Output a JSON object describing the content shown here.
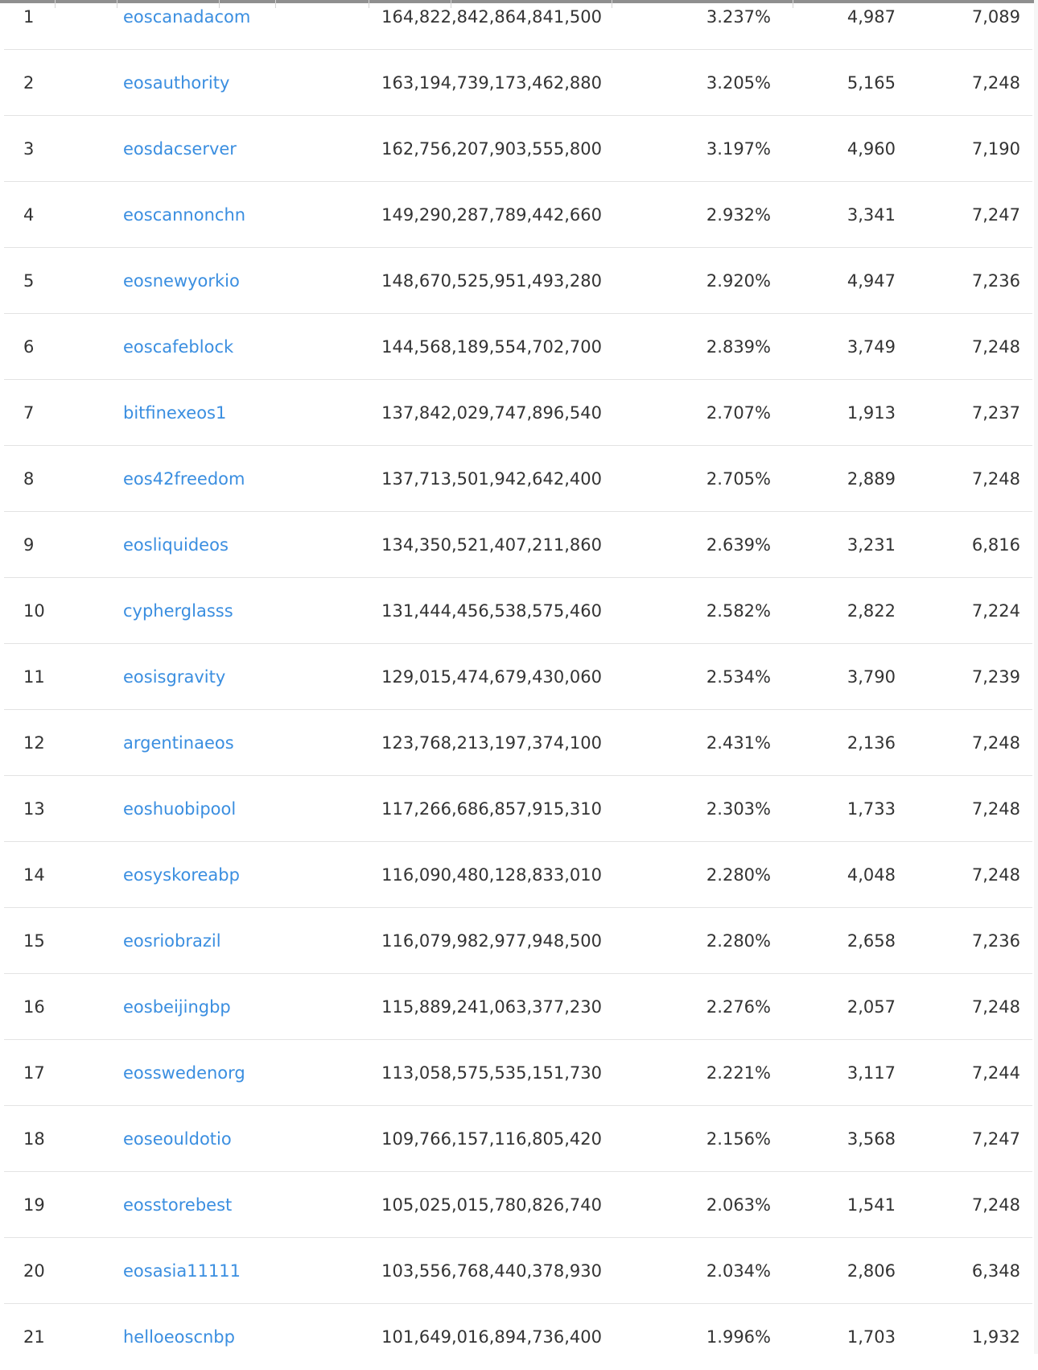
{
  "table": {
    "rows": [
      {
        "rank": "1",
        "name": "eoscanadacom",
        "votes": "164,822,842,864,841,500",
        "percent": "3.237%",
        "produced": "4,987",
        "total": "7,089"
      },
      {
        "rank": "2",
        "name": "eosauthority",
        "votes": "163,194,739,173,462,880",
        "percent": "3.205%",
        "produced": "5,165",
        "total": "7,248"
      },
      {
        "rank": "3",
        "name": "eosdacserver",
        "votes": "162,756,207,903,555,800",
        "percent": "3.197%",
        "produced": "4,960",
        "total": "7,190"
      },
      {
        "rank": "4",
        "name": "eoscannonchn",
        "votes": "149,290,287,789,442,660",
        "percent": "2.932%",
        "produced": "3,341",
        "total": "7,247"
      },
      {
        "rank": "5",
        "name": "eosnewyorkio",
        "votes": "148,670,525,951,493,280",
        "percent": "2.920%",
        "produced": "4,947",
        "total": "7,236"
      },
      {
        "rank": "6",
        "name": "eoscafeblock",
        "votes": "144,568,189,554,702,700",
        "percent": "2.839%",
        "produced": "3,749",
        "total": "7,248"
      },
      {
        "rank": "7",
        "name": "bitfinexeos1",
        "votes": "137,842,029,747,896,540",
        "percent": "2.707%",
        "produced": "1,913",
        "total": "7,237"
      },
      {
        "rank": "8",
        "name": "eos42freedom",
        "votes": "137,713,501,942,642,400",
        "percent": "2.705%",
        "produced": "2,889",
        "total": "7,248"
      },
      {
        "rank": "9",
        "name": "eosliquideos",
        "votes": "134,350,521,407,211,860",
        "percent": "2.639%",
        "produced": "3,231",
        "total": "6,816"
      },
      {
        "rank": "10",
        "name": "cypherglasss",
        "votes": "131,444,456,538,575,460",
        "percent": "2.582%",
        "produced": "2,822",
        "total": "7,224"
      },
      {
        "rank": "11",
        "name": "eosisgravity",
        "votes": "129,015,474,679,430,060",
        "percent": "2.534%",
        "produced": "3,790",
        "total": "7,239"
      },
      {
        "rank": "12",
        "name": "argentinaeos",
        "votes": "123,768,213,197,374,100",
        "percent": "2.431%",
        "produced": "2,136",
        "total": "7,248"
      },
      {
        "rank": "13",
        "name": "eoshuobipool",
        "votes": "117,266,686,857,915,310",
        "percent": "2.303%",
        "produced": "1,733",
        "total": "7,248"
      },
      {
        "rank": "14",
        "name": "eosyskoreabp",
        "votes": "116,090,480,128,833,010",
        "percent": "2.280%",
        "produced": "4,048",
        "total": "7,248"
      },
      {
        "rank": "15",
        "name": "eosriobrazil",
        "votes": "116,079,982,977,948,500",
        "percent": "2.280%",
        "produced": "2,658",
        "total": "7,236"
      },
      {
        "rank": "16",
        "name": "eosbeijingbp",
        "votes": "115,889,241,063,377,230",
        "percent": "2.276%",
        "produced": "2,057",
        "total": "7,248"
      },
      {
        "rank": "17",
        "name": "eosswedenorg",
        "votes": "113,058,575,535,151,730",
        "percent": "2.221%",
        "produced": "3,117",
        "total": "7,244"
      },
      {
        "rank": "18",
        "name": "eoseouldotio",
        "votes": "109,766,157,116,805,420",
        "percent": "2.156%",
        "produced": "3,568",
        "total": "7,247"
      },
      {
        "rank": "19",
        "name": "eosstorebest",
        "votes": "105,025,015,780,826,740",
        "percent": "2.063%",
        "produced": "1,541",
        "total": "7,248"
      },
      {
        "rank": "20",
        "name": "eosasia11111",
        "votes": "103,556,768,440,378,930",
        "percent": "2.034%",
        "produced": "2,806",
        "total": "6,348"
      },
      {
        "rank": "21",
        "name": "helloeoscnbp",
        "votes": "101,649,016,894,736,400",
        "percent": "1.996%",
        "produced": "1,703",
        "total": "1,932"
      }
    ]
  },
  "colors": {
    "link": "#3a8ee0",
    "text": "#333333",
    "divider": "#e3e3e3"
  }
}
